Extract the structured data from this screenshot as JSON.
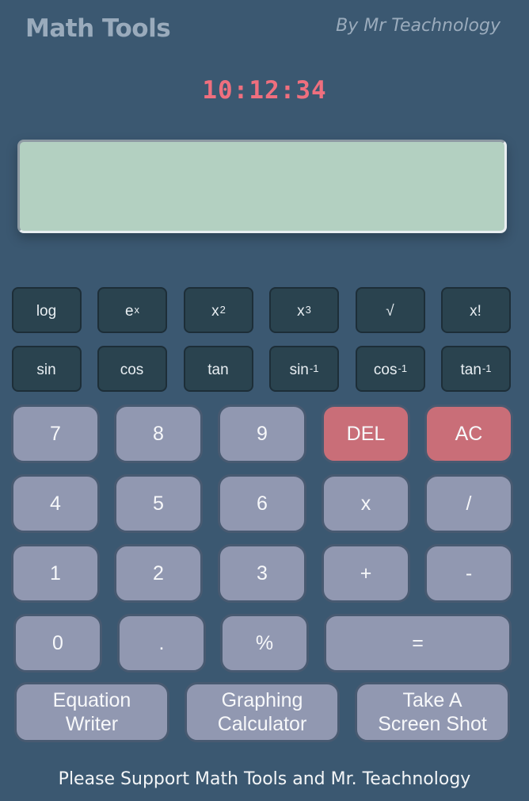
{
  "header": {
    "title": "Math Tools",
    "author": "By Mr Teachnology"
  },
  "clock": {
    "time": "10:12:34"
  },
  "display": {
    "value": ""
  },
  "functions_row1": [
    {
      "base": "log",
      "sup": ""
    },
    {
      "base": "e",
      "sup": "x"
    },
    {
      "base": "x",
      "sup": "2"
    },
    {
      "base": "x",
      "sup": "3"
    },
    {
      "base": "√",
      "sup": ""
    },
    {
      "base": "x!",
      "sup": ""
    }
  ],
  "functions_row2": [
    {
      "base": "sin",
      "sup": ""
    },
    {
      "base": "cos",
      "sup": ""
    },
    {
      "base": "tan",
      "sup": ""
    },
    {
      "base": "sin",
      "sup": "-1"
    },
    {
      "base": "cos",
      "sup": "-1"
    },
    {
      "base": "tan",
      "sup": "-1"
    }
  ],
  "keypad": {
    "row1": [
      "7",
      "8",
      "9",
      "DEL",
      "AC"
    ],
    "row2": [
      "4",
      "5",
      "6",
      "x",
      "/"
    ],
    "row3": [
      "1",
      "2",
      "3",
      "+",
      "-"
    ],
    "row4": [
      "0",
      ".",
      "%",
      "="
    ]
  },
  "bottom_buttons": [
    {
      "line1": "Equation",
      "line2": "Writer"
    },
    {
      "line1": "Graphing",
      "line2": "Calculator"
    },
    {
      "line1": "Take A",
      "line2": "Screen Shot"
    }
  ],
  "footer": {
    "text": "Please Support Math Tools and Mr. Teachnology"
  },
  "colors": {
    "background": "#3b5871",
    "display": "#b3d0c1",
    "clock": "#ef6f7e",
    "function_button": "#2a434f",
    "key": "#9198b1",
    "danger_key": "#c96e78"
  }
}
